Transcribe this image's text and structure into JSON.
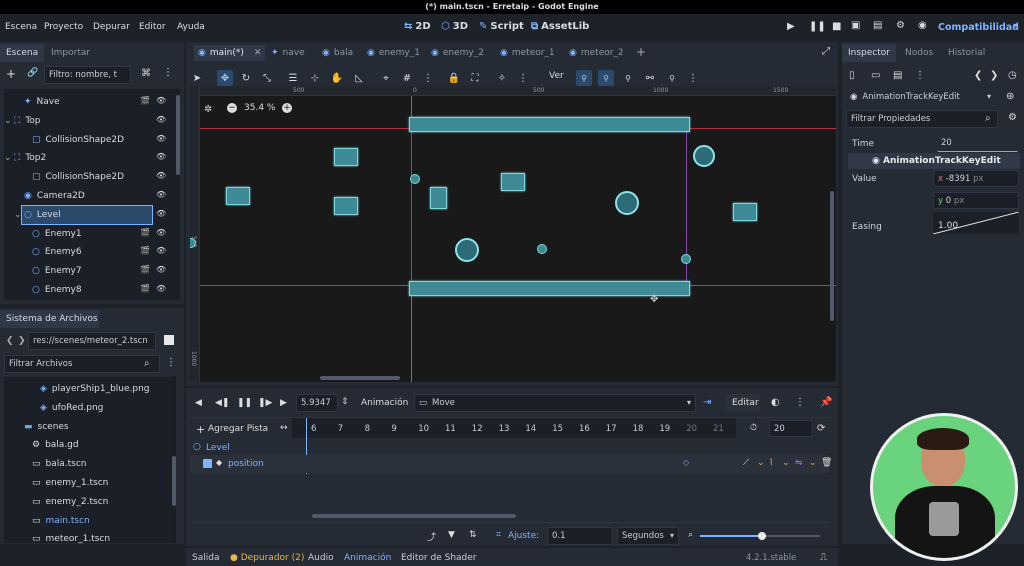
{
  "window": {
    "title": "(*) main.tscn - Erretaip - Godot Engine"
  },
  "menu": [
    "Escena",
    "Proyecto",
    "Depurar",
    "Editor",
    "Ayuda"
  ],
  "workspaces": [
    {
      "label": "2D",
      "active": true
    },
    {
      "label": "3D"
    },
    {
      "label": "Script"
    },
    {
      "label": "AssetLib"
    }
  ],
  "renderer": "Compatibilidad",
  "scene_panel": {
    "tabs": [
      "Escena",
      "Importar"
    ],
    "filter_placeholder": "Filtro: nombre, t",
    "nodes": [
      {
        "label": "Nave",
        "type": "character"
      },
      {
        "label": "Top",
        "type": "area"
      },
      {
        "label": "CollisionShape2D",
        "type": "shape"
      },
      {
        "label": "Top2",
        "type": "area"
      },
      {
        "label": "CollisionShape2D",
        "type": "shape"
      },
      {
        "label": "Camera2D",
        "type": "camera"
      },
      {
        "label": "Level",
        "type": "node2d",
        "selected": true
      },
      {
        "label": "Enemy1",
        "type": "node2d"
      },
      {
        "label": "Enemy6",
        "type": "node2d"
      },
      {
        "label": "Enemy7",
        "type": "node2d"
      },
      {
        "label": "Enemy8",
        "type": "node2d"
      }
    ]
  },
  "filesystem": {
    "title": "Sistema de Archivos",
    "path": "res://scenes/meteor_2.tscn",
    "filter_placeholder": "Filtrar Archivos",
    "files": [
      {
        "label": "playerShip1_blue.png",
        "kind": "image"
      },
      {
        "label": "ufoRed.png",
        "kind": "image"
      },
      {
        "label": "scenes",
        "kind": "folder"
      },
      {
        "label": "bala.gd",
        "kind": "script"
      },
      {
        "label": "bala.tscn",
        "kind": "scene"
      },
      {
        "label": "enemy_1.tscn",
        "kind": "scene"
      },
      {
        "label": "enemy_2.tscn",
        "kind": "scene"
      },
      {
        "label": "main.tscn",
        "kind": "scene",
        "highlight": true
      },
      {
        "label": "meteor_1.tscn",
        "kind": "scene"
      },
      {
        "label": "meteor_2.tscn",
        "kind": "scene",
        "selected": true
      }
    ]
  },
  "editor_tabs": [
    "main(*)",
    "nave",
    "bala",
    "enemy_1",
    "enemy_2",
    "meteor_1",
    "meteor_2"
  ],
  "toolbar": {
    "view_label": "Ver"
  },
  "viewport": {
    "zoom": "35.4 %",
    "ruler": [
      "500",
      "0",
      "500",
      "1000",
      "1500"
    ],
    "vruler": [
      "500",
      "1000"
    ]
  },
  "animation": {
    "time": "5.9347",
    "animation_label": "Animación",
    "animation_name": "Move",
    "edit_label": "Editar",
    "add_track": "Agregar Pista",
    "track_node": "Level",
    "track_prop": "position",
    "timeline": [
      "6",
      "7",
      "8",
      "9",
      "10",
      "11",
      "12",
      "13",
      "14",
      "15",
      "16",
      "17",
      "18",
      "19",
      "20",
      "21"
    ],
    "length": "20",
    "snap_label": "Ajuste:",
    "snap_value": "0.1",
    "snap_unit": "Segundos"
  },
  "inspector": {
    "tabs": [
      "Inspector",
      "Nodos",
      "Historial"
    ],
    "object": "AnimationTrackKeyEdit",
    "filter_placeholder": "Filtrar Propiedades",
    "time_label": "Time",
    "time_value": "20",
    "section": "AnimationTrackKeyEdit",
    "value_label": "Value",
    "x_label": "x",
    "x_value": "-8391",
    "y_label": "y",
    "y_value": "0",
    "unit": "px",
    "easing_label": "Easing",
    "easing_value": "1.00"
  },
  "bottom_tabs": [
    {
      "label": "Salida"
    },
    {
      "label": "Depurador (2)",
      "warn": true
    },
    {
      "label": "Audio"
    },
    {
      "label": "Animación",
      "active": true
    },
    {
      "label": "Editor de Shader"
    }
  ],
  "version": "4.2.1.stable",
  "colors": {
    "accent": "#7eb3ff",
    "selection": "#2c4a6b",
    "sprite": "#3e8a96",
    "guide_red": "#b03040",
    "guide_purple": "#8a3fb8"
  }
}
